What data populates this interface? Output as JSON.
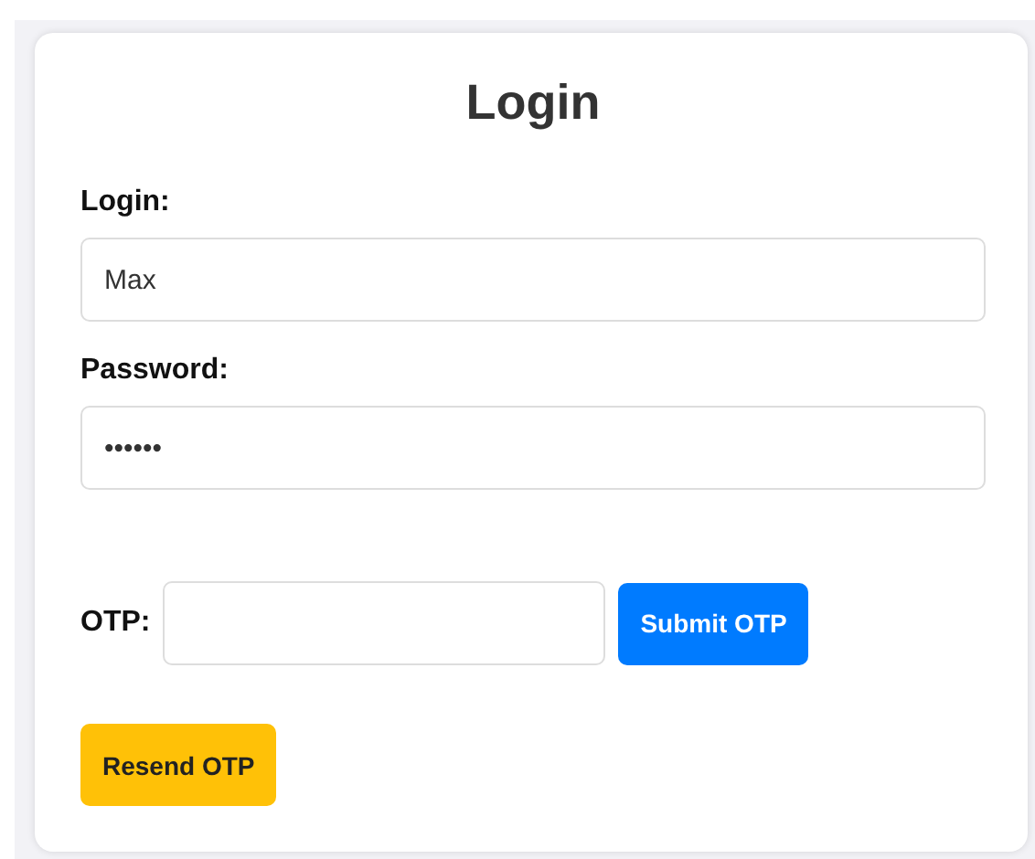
{
  "title": "Login",
  "fields": [
    {
      "label": "Login:",
      "value": "Max"
    },
    {
      "label": "Password:",
      "value": "••••••"
    }
  ],
  "otp": {
    "label": "OTP:",
    "button": "Submit OTP"
  },
  "resend_button": "Resend OTP"
}
